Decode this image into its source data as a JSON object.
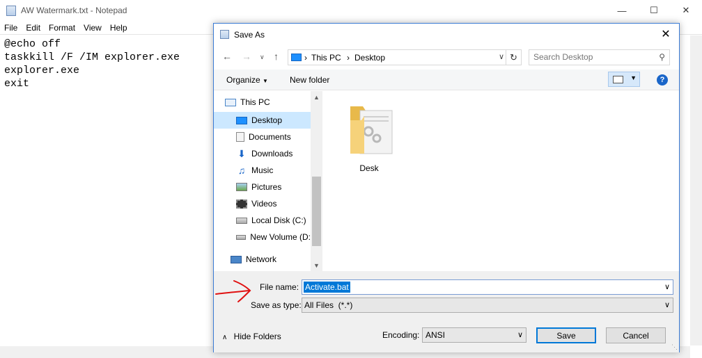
{
  "notepad": {
    "title": "AW Watermark.txt - Notepad",
    "menu": [
      "File",
      "Edit",
      "Format",
      "View",
      "Help"
    ],
    "lines": [
      "@echo off",
      "taskkill /F /IM explorer.exe",
      "explorer.exe",
      "exit"
    ]
  },
  "dialog": {
    "title": "Save As",
    "address": {
      "root": "This PC",
      "current": "Desktop"
    },
    "search_placeholder": "Search Desktop",
    "toolbar": {
      "organize": "Organize",
      "new_folder": "New folder"
    },
    "nav_items": [
      {
        "label": "This PC",
        "icon": "computer-icon"
      },
      {
        "label": "Desktop",
        "icon": "desktop-icon",
        "selected": true
      },
      {
        "label": "Documents",
        "icon": "documents-icon"
      },
      {
        "label": "Downloads",
        "icon": "downloads-icon"
      },
      {
        "label": "Music",
        "icon": "music-icon"
      },
      {
        "label": "Pictures",
        "icon": "pictures-icon"
      },
      {
        "label": "Videos",
        "icon": "videos-icon"
      },
      {
        "label": "Local Disk (C:)",
        "icon": "drive-icon"
      },
      {
        "label": "New Volume (D:",
        "icon": "drive-icon"
      },
      {
        "label": "Network",
        "icon": "network-icon"
      }
    ],
    "files": [
      {
        "name": "Desk",
        "icon": "folder-icon"
      }
    ],
    "file_name_label": "File name:",
    "file_name_value": "Activate.bat",
    "save_type_label": "Save as type:",
    "save_type_value": "All Files  (*.*)",
    "hide_folders": "Hide Folders",
    "encoding_label": "Encoding:",
    "encoding_value": "ANSI",
    "save_button": "Save",
    "cancel_button": "Cancel"
  },
  "colors": {
    "selection": "#0078d7",
    "nav_selected": "#cce8ff",
    "annotation": "#e01010"
  }
}
